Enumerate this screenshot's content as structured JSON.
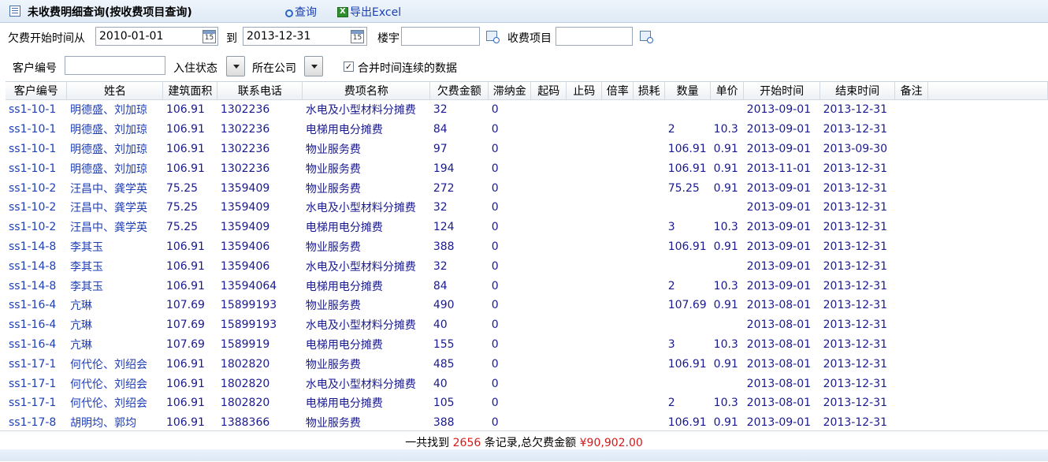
{
  "header": {
    "title": "未收费明细查询(按收费项目查询)",
    "query_label": "查询",
    "export_label": "导出Excel"
  },
  "filters": {
    "start_label": "欠费开始时间从",
    "start_value": "2010-01-01",
    "to_label": "到",
    "end_value": "2013-12-31",
    "cal_text": "15",
    "building_label": "楼宇",
    "building_value": "",
    "item_label": "收费项目",
    "item_value": "",
    "customer_label": "客户编号",
    "customer_value": "",
    "status_label": "入住状态",
    "company_label": "所在公司",
    "merge_label": "合并时间连续的数据",
    "merge_checked": true
  },
  "table": {
    "columns": [
      "客户编号",
      "姓名",
      "建筑面积",
      "联系电话",
      "费项名称",
      "欠费金额",
      "滞纳金",
      "起码",
      "止码",
      "倍率",
      "损耗",
      "数量",
      "单价",
      "开始时间",
      "结束时间",
      "备注"
    ],
    "rows": [
      [
        "ss1-10-1",
        "明德盛、刘加琼",
        "106.91",
        "1302236",
        "水电及小型材料分摊费",
        "32",
        "0",
        "",
        "",
        "",
        "",
        "",
        "",
        "2013-09-01",
        "2013-12-31",
        ""
      ],
      [
        "ss1-10-1",
        "明德盛、刘加琼",
        "106.91",
        "1302236",
        "电梯用电分摊费",
        "84",
        "0",
        "",
        "",
        "",
        "",
        "2",
        "10.3",
        "2013-09-01",
        "2013-12-31",
        ""
      ],
      [
        "ss1-10-1",
        "明德盛、刘加琼",
        "106.91",
        "1302236",
        "物业服务费",
        "97",
        "0",
        "",
        "",
        "",
        "",
        "106.91",
        "0.91",
        "2013-09-01",
        "2013-09-30",
        ""
      ],
      [
        "ss1-10-1",
        "明德盛、刘加琼",
        "106.91",
        "1302236",
        "物业服务费",
        "194",
        "0",
        "",
        "",
        "",
        "",
        "106.91",
        "0.91",
        "2013-11-01",
        "2013-12-31",
        ""
      ],
      [
        "ss1-10-2",
        "汪昌中、龚学英",
        "75.25",
        "1359409",
        "物业服务费",
        "272",
        "0",
        "",
        "",
        "",
        "",
        "75.25",
        "0.91",
        "2013-09-01",
        "2013-12-31",
        ""
      ],
      [
        "ss1-10-2",
        "汪昌中、龚学英",
        "75.25",
        "1359409",
        "水电及小型材料分摊费",
        "32",
        "0",
        "",
        "",
        "",
        "",
        "",
        "",
        "2013-09-01",
        "2013-12-31",
        ""
      ],
      [
        "ss1-10-2",
        "汪昌中、龚学英",
        "75.25",
        "1359409",
        "电梯用电分摊费",
        "124",
        "0",
        "",
        "",
        "",
        "",
        "3",
        "10.3",
        "2013-09-01",
        "2013-12-31",
        ""
      ],
      [
        "ss1-14-8",
        "李其玉",
        "106.91",
        "1359406",
        "物业服务费",
        "388",
        "0",
        "",
        "",
        "",
        "",
        "106.91",
        "0.91",
        "2013-09-01",
        "2013-12-31",
        ""
      ],
      [
        "ss1-14-8",
        "李其玉",
        "106.91",
        "1359406",
        "水电及小型材料分摊费",
        "32",
        "0",
        "",
        "",
        "",
        "",
        "",
        "",
        "2013-09-01",
        "2013-12-31",
        ""
      ],
      [
        "ss1-14-8",
        "李其玉",
        "106.91",
        "13594064",
        "电梯用电分摊费",
        "84",
        "0",
        "",
        "",
        "",
        "",
        "2",
        "10.3",
        "2013-09-01",
        "2013-12-31",
        ""
      ],
      [
        "ss1-16-4",
        "亢琳",
        "107.69",
        "15899193",
        "物业服务费",
        "490",
        "0",
        "",
        "",
        "",
        "",
        "107.69",
        "0.91",
        "2013-08-01",
        "2013-12-31",
        ""
      ],
      [
        "ss1-16-4",
        "亢琳",
        "107.69",
        "15899193",
        "水电及小型材料分摊费",
        "40",
        "0",
        "",
        "",
        "",
        "",
        "",
        "",
        "2013-08-01",
        "2013-12-31",
        ""
      ],
      [
        "ss1-16-4",
        "亢琳",
        "107.69",
        "1589919",
        "电梯用电分摊费",
        "155",
        "0",
        "",
        "",
        "",
        "",
        "3",
        "10.3",
        "2013-08-01",
        "2013-12-31",
        ""
      ],
      [
        "ss1-17-1",
        "何代伦、刘绍会",
        "106.91",
        "1802820",
        "物业服务费",
        "485",
        "0",
        "",
        "",
        "",
        "",
        "106.91",
        "0.91",
        "2013-08-01",
        "2013-12-31",
        ""
      ],
      [
        "ss1-17-1",
        "何代伦、刘绍会",
        "106.91",
        "1802820",
        "水电及小型材料分摊费",
        "40",
        "0",
        "",
        "",
        "",
        "",
        "",
        "",
        "2013-08-01",
        "2013-12-31",
        ""
      ],
      [
        "ss1-17-1",
        "何代伦、刘绍会",
        "106.91",
        "1802820",
        "电梯用电分摊费",
        "105",
        "0",
        "",
        "",
        "",
        "",
        "2",
        "10.3",
        "2013-08-01",
        "2013-12-31",
        ""
      ],
      [
        "ss1-17-8",
        "胡明均、郭均",
        "106.91",
        "1388366",
        "物业服务费",
        "388",
        "0",
        "",
        "",
        "",
        "",
        "106.91",
        "0.91",
        "2013-09-01",
        "2013-12-31",
        ""
      ]
    ]
  },
  "footer": {
    "prefix": "一共找到",
    "count": "2656",
    "middle": "条记录,总欠费金额",
    "total": "¥90,902.00"
  }
}
